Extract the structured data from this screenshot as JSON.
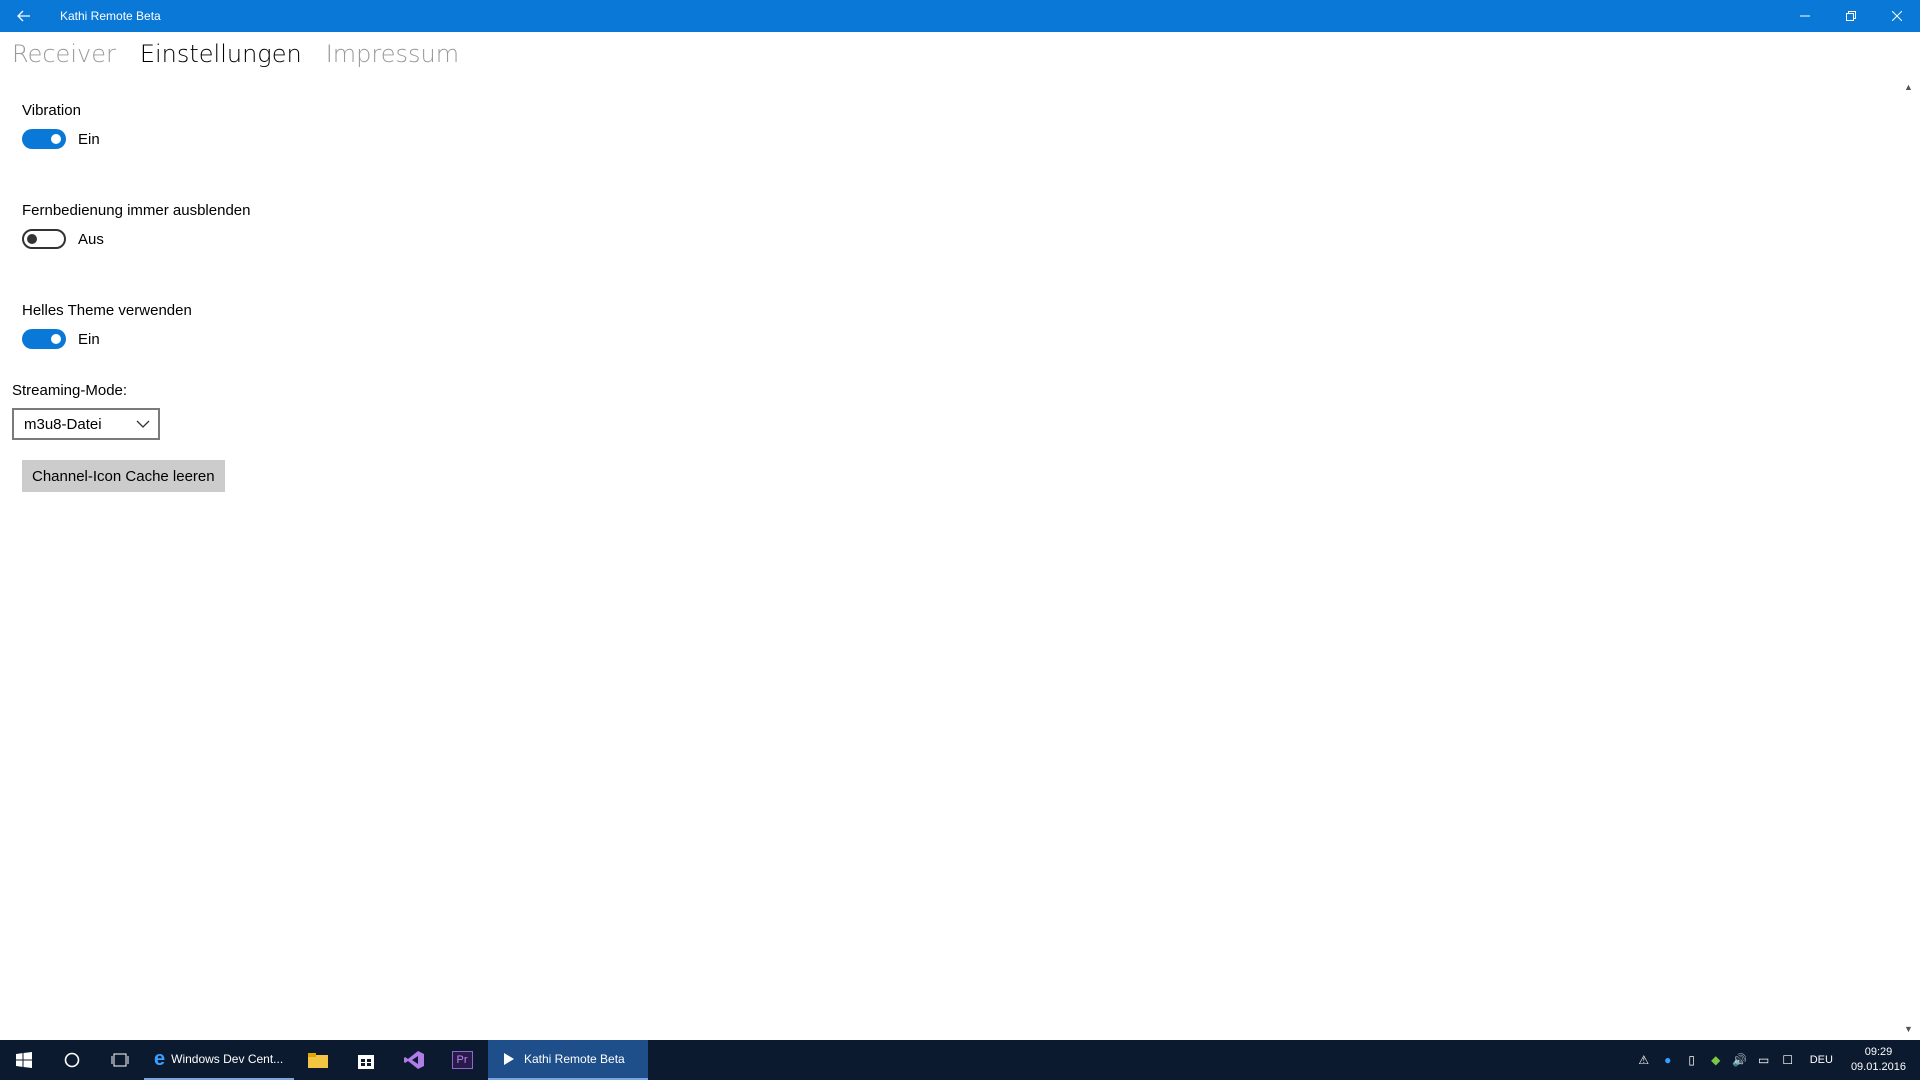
{
  "window": {
    "title": "Kathi Remote Beta"
  },
  "tabs": [
    {
      "label": "Receiver",
      "active": false
    },
    {
      "label": "Einstellungen",
      "active": true
    },
    {
      "label": "Impressum",
      "active": false
    }
  ],
  "settings": {
    "vibration": {
      "label": "Vibration",
      "state": "Ein",
      "on": true
    },
    "hide_remote": {
      "label": "Fernbedienung immer ausblenden",
      "state": "Aus",
      "on": false
    },
    "light_theme": {
      "label": "Helles Theme verwenden",
      "state": "Ein",
      "on": true
    },
    "streaming_mode": {
      "label": "Streaming-Mode:",
      "value": "m3u8-Datei"
    },
    "clear_cache_label": "Channel-Icon Cache leeren"
  },
  "taskbar": {
    "apps": [
      {
        "label": "Windows Dev Cent...",
        "icon": "edge-icon"
      },
      {
        "label": "",
        "icon": "file-explorer-icon"
      },
      {
        "label": "",
        "icon": "store-icon"
      },
      {
        "label": "",
        "icon": "visual-studio-icon"
      },
      {
        "label": "Pr",
        "icon": "premiere-icon"
      },
      {
        "label": "Kathi Remote Beta",
        "icon": "play-icon"
      }
    ],
    "language": "DEU",
    "time": "09:29",
    "date": "09.01.2016"
  },
  "colors": {
    "accent": "#0a78d7",
    "taskbar": "#0b1a2e"
  }
}
